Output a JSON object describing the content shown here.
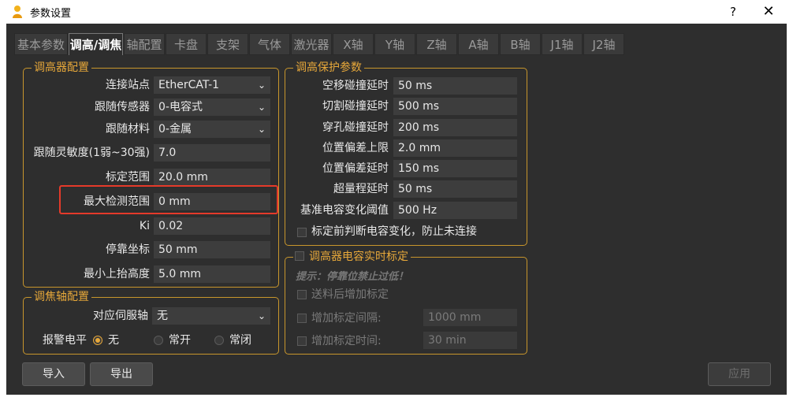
{
  "window": {
    "title": "参数设置",
    "help": "?",
    "close": "✕"
  },
  "tabs": [
    "基本参数",
    "调高/调焦",
    "轴配置",
    "卡盘",
    "支架",
    "气体",
    "激光器",
    "X轴",
    "Y轴",
    "Z轴",
    "A轴",
    "B轴",
    "J1轴",
    "J2轴"
  ],
  "active_tab": "调高/调焦",
  "height_config": {
    "title": "调高器配置",
    "station_label": "连接站点",
    "station_value": "EtherCAT-1",
    "sensor_label": "跟随传感器",
    "sensor_value": "0-电容式",
    "material_label": "跟随材料",
    "material_value": "0-金属",
    "sensitivity_label": "跟随灵敏度(1弱~30强)",
    "sensitivity_value": "7.0",
    "calib_range_label": "标定范围",
    "calib_range_value": "20.0 mm",
    "max_detect_label": "最大检测范围",
    "max_detect_value": "0 mm",
    "ki_label": "Ki",
    "ki_value": "0.02",
    "park_label": "停靠坐标",
    "park_value": "50 mm",
    "min_lift_label": "最小上抬高度",
    "min_lift_value": "5.0 mm"
  },
  "focus_config": {
    "title": "调焦轴配置",
    "servo_label": "对应伺服轴",
    "servo_value": "无",
    "alarm_label": "报警电平",
    "alarm_options": [
      "无",
      "常开",
      "常闭"
    ],
    "alarm_selected": "无"
  },
  "protect": {
    "title": "调高保护参数",
    "move_label": "空移碰撞延时",
    "move_value": "50 ms",
    "cut_label": "切割碰撞延时",
    "cut_value": "500 ms",
    "pierce_label": "穿孔碰撞延时",
    "pierce_value": "200 ms",
    "pos_upper_label": "位置偏差上限",
    "pos_upper_value": "2.0 mm",
    "pos_delay_label": "位置偏差延时",
    "pos_delay_value": "150 ms",
    "overrange_label": "超量程延时",
    "overrange_value": "50 ms",
    "cap_thresh_label": "基准电容变化阈值",
    "cap_thresh_value": "500 Hz",
    "pre_check_label": "标定前判断电容变化，防止未连接"
  },
  "realtime": {
    "title": "调高器电容实时标定",
    "hint": "提示：停靠位禁止过低！",
    "after_feed_label": "送料后增加标定",
    "interval_label": "增加标定间隔:",
    "interval_value": "1000 mm",
    "time_label": "增加标定时间:",
    "time_value": "30 min"
  },
  "buttons": {
    "import": "导入",
    "export": "导出",
    "apply": "应用"
  },
  "colors": {
    "accent": "#e7a83a",
    "background": "#2e2e2e",
    "highlight": "#e53a2a"
  }
}
